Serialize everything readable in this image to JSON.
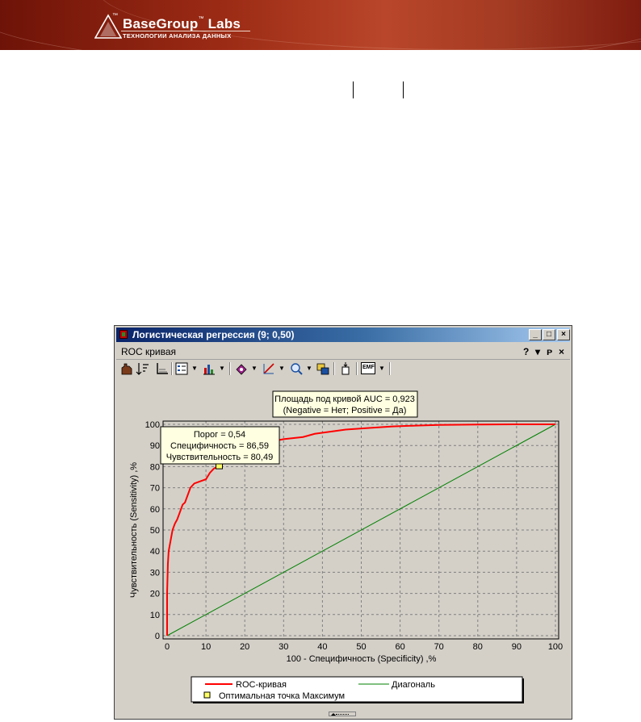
{
  "brand": {
    "name": "BaseGroup",
    "tm": "™",
    "name_suffix": "Labs",
    "tagline": "ТЕХНОЛОГИИ АНАЛИЗА ДАННЫХ"
  },
  "window": {
    "title": "Логистическая регрессия (9; 0,50)",
    "minimize": "_",
    "maximize": "□",
    "close": "×",
    "pane_title": "ROC кривая",
    "pane_help": "?",
    "pane_dropdown": "▾",
    "pane_pin": "ᴘ",
    "pane_close": "×"
  },
  "toolbar": {
    "icons": [
      "hand-icon",
      "sort-icon",
      "axes-icon",
      "legend-icon",
      "bar-chart-icon",
      "palette-icon",
      "line-color-icon",
      "zoom-icon",
      "copy-icon",
      "export-icon",
      "emf-icon"
    ],
    "emf_label": "EMF"
  },
  "chart_data": {
    "type": "line",
    "xlabel": "100 - Специфичность (Specificity) ,%",
    "ylabel": "Чувствительность (Sensitivity) ,%",
    "xlim": [
      0,
      100
    ],
    "ylim": [
      0,
      100
    ],
    "x_ticks": [
      0,
      10,
      20,
      30,
      40,
      50,
      60,
      70,
      80,
      90,
      100
    ],
    "y_ticks": [
      0,
      10,
      20,
      30,
      40,
      50,
      60,
      70,
      80,
      90,
      100
    ],
    "grid": true,
    "auc_label_line1": "Площадь под кривой AUC = 0,923",
    "auc_label_line2": "(Negative = Нет; Positive = Да)",
    "tooltip": {
      "threshold": "Порог =  0,54",
      "specificity": "Специфичность = 86,59",
      "sensitivity": "Чувствительность = 80,49"
    },
    "optimal_point": {
      "x": 13.41,
      "y": 80.49
    },
    "series": [
      {
        "name": "ROC-кривая",
        "color": "#ff0000",
        "x": [
          0,
          0,
          0.2,
          0.4,
          0.6,
          1,
          1.4,
          2,
          2.6,
          3.2,
          4,
          4.6,
          5.2,
          6,
          7,
          8.5,
          10,
          11,
          12,
          13.41,
          15,
          17,
          19,
          21,
          23,
          26,
          30,
          35,
          38,
          42,
          46,
          52,
          58,
          64,
          70,
          80,
          90,
          100
        ],
        "y": [
          0,
          20,
          34,
          40,
          42,
          46,
          50,
          53,
          55,
          58,
          62,
          63,
          66,
          70,
          72,
          73,
          74,
          77,
          79,
          80.49,
          82,
          84,
          86,
          88,
          90,
          91.5,
          93,
          94,
          95.5,
          96.5,
          97.5,
          98.3,
          99,
          99.4,
          99.7,
          99.9,
          100,
          100
        ]
      },
      {
        "name": "Диагональ",
        "color": "#008000",
        "x": [
          0,
          100
        ],
        "y": [
          0,
          100
        ]
      }
    ],
    "legend": {
      "roc": "ROC-кривая",
      "diagonal": "Диагональ",
      "optimal": "Оптимальная точка Максимум"
    },
    "colors": {
      "roc": "#ff0000",
      "diagonal": "#008000",
      "optimal_fill": "#ffff66",
      "tooltip_bg": "#ffffe1"
    }
  }
}
